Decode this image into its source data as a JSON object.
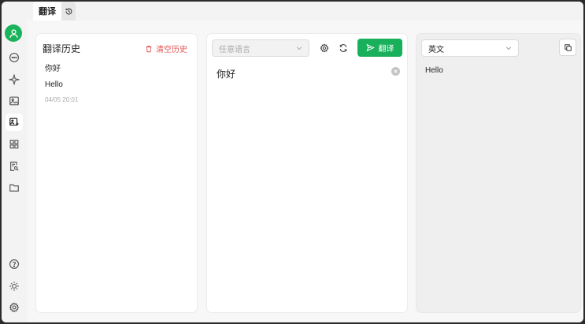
{
  "tabs": {
    "active_label": "翻译"
  },
  "sidebar": {
    "items": [
      {
        "name": "chat-icon"
      },
      {
        "name": "sparkle-icon"
      },
      {
        "name": "image-icon"
      },
      {
        "name": "translate-image-icon"
      },
      {
        "name": "apps-icon"
      },
      {
        "name": "document-search-icon"
      },
      {
        "name": "folder-icon"
      }
    ],
    "bottom": [
      {
        "name": "help-icon"
      },
      {
        "name": "theme-icon"
      },
      {
        "name": "settings-icon"
      }
    ]
  },
  "history": {
    "title": "翻译历史",
    "clear_label": "清空历史",
    "items": [
      {
        "source": "你好",
        "target": "Hello",
        "time": "04/05 20:01"
      }
    ]
  },
  "source": {
    "language_placeholder": "任意语言",
    "text": "你好",
    "translate_label": "翻译"
  },
  "target": {
    "language": "英文",
    "text": "Hello"
  },
  "colors": {
    "accent": "#18b05a",
    "danger": "#e05454"
  }
}
